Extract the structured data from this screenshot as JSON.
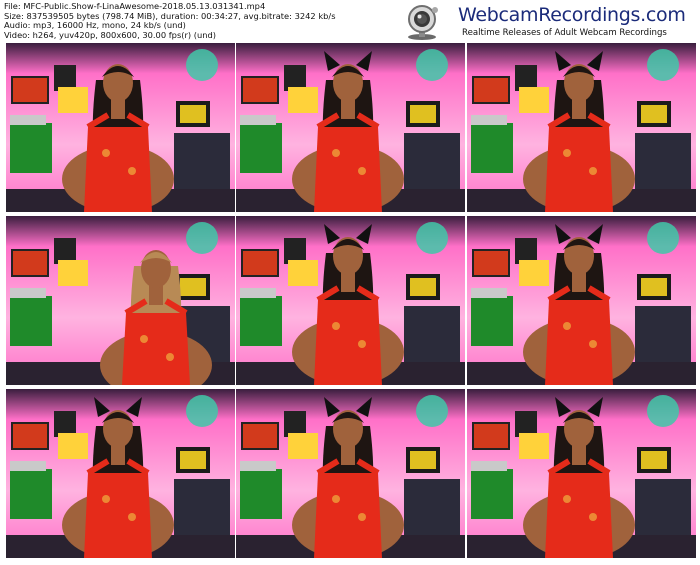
{
  "file_info": {
    "line1": "File: MFC-Public.Show-f-LinaAwesome-2018.05.13.031341.mp4",
    "line2": "Size: 837539505 bytes (798.74 MiB), duration: 00:34:27, avg.bitrate: 3242 kb/s",
    "line3": "Audio: mp3, 16000 Hz, mono, 24 kb/s (und)",
    "line4": "Video: h264, yuv420p, 800x600, 30.00 fps(r) (und)"
  },
  "logo": {
    "title": "WebcamRecordings.com",
    "tagline": "Realtime Releases of Adult Webcam Recordings",
    "icon": "webcam-icon"
  },
  "thumbnails": [
    {
      "id": "frame-1",
      "pose": "center",
      "ears": false,
      "hair": "#1e1512"
    },
    {
      "id": "frame-2",
      "pose": "center",
      "ears": true,
      "hair": "#1e1512"
    },
    {
      "id": "frame-3",
      "pose": "center",
      "ears": true,
      "hair": "#1e1512"
    },
    {
      "id": "frame-4",
      "pose": "leaning",
      "ears": false,
      "hair": "#b88a55"
    },
    {
      "id": "frame-5",
      "pose": "center",
      "ears": true,
      "hair": "#1e1512"
    },
    {
      "id": "frame-6",
      "pose": "center",
      "ears": true,
      "hair": "#1e1512"
    },
    {
      "id": "frame-7",
      "pose": "center",
      "ears": true,
      "hair": "#1e1512"
    },
    {
      "id": "frame-8",
      "pose": "center",
      "ears": true,
      "hair": "#1e1512"
    },
    {
      "id": "frame-9",
      "pose": "center",
      "ears": true,
      "hair": "#1e1512"
    }
  ],
  "colors": {
    "wall": "#ff70c8",
    "wall_light": "#ffb3e0",
    "top_dark": "#3a1e3e",
    "dress": "#e52b1a",
    "skin": "#a0623c",
    "monitor_green": "#1f8a2a",
    "desk": "#2a2230"
  }
}
